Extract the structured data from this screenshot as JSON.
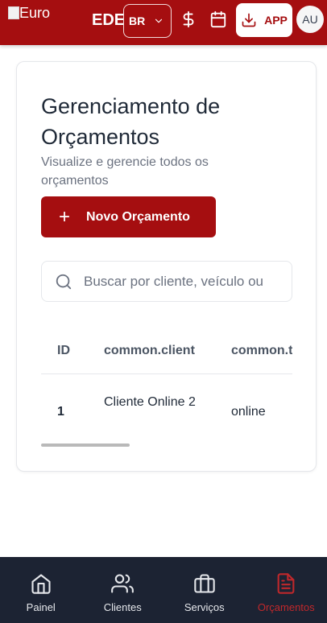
{
  "header": {
    "logo_alt": "Euro",
    "logo_fragment": "_",
    "brand": "EDE",
    "language": "BR",
    "app_label": "APP",
    "avatar_initials": "AU",
    "accent_color": "#a50e10",
    "icons": [
      "chevron-down-icon",
      "dollar-icon",
      "calendar-icon",
      "download-icon"
    ]
  },
  "page": {
    "title": "Gerenciamento de Orçamentos",
    "subtitle": "Visualize e gerencie todos os orçamentos",
    "new_button": "Novo Orçamento",
    "search_placeholder": "Buscar por cliente, veículo ou"
  },
  "table": {
    "headers": [
      "ID",
      "common.client",
      "common.type"
    ],
    "rows": [
      {
        "id": "1",
        "client": "Cliente Online 2",
        "type": "online"
      }
    ]
  },
  "bottom_nav": {
    "items": [
      {
        "label": "Painel",
        "icon": "home-icon"
      },
      {
        "label": "Clientes",
        "icon": "users-icon"
      },
      {
        "label": "Serviços",
        "icon": "briefcase-icon"
      },
      {
        "label": "Orçamentos",
        "icon": "document-icon",
        "active": true
      }
    ],
    "background": "#1c2333",
    "active_color": "#c0282b"
  }
}
